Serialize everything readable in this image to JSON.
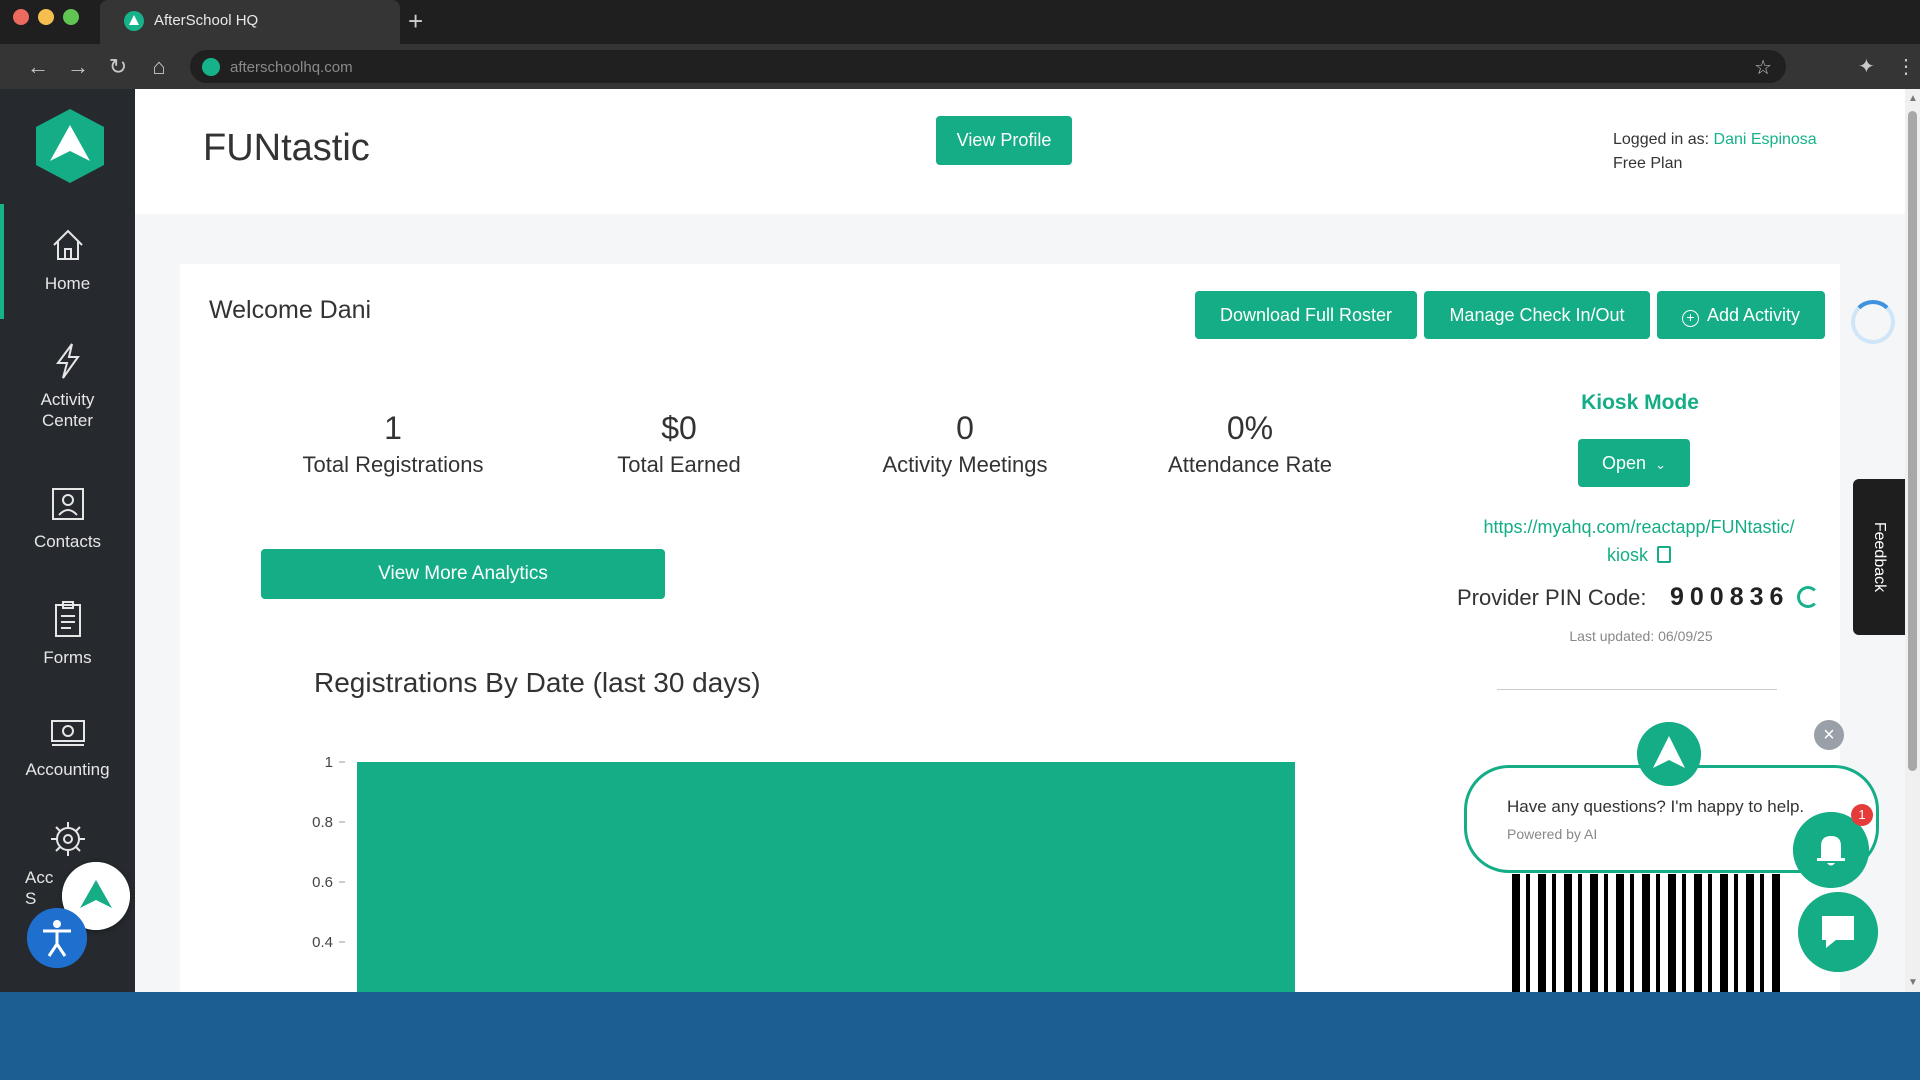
{
  "browser": {
    "tab_title": "AfterSchool HQ",
    "url": "afterschoolhq.com"
  },
  "sidebar": {
    "items": [
      {
        "label": "Home",
        "icon": "home-icon"
      },
      {
        "label": "Activity Center",
        "icon": "lightning-icon"
      },
      {
        "label": "Contacts",
        "icon": "contacts-icon"
      },
      {
        "label": "Forms",
        "icon": "clipboard-icon"
      },
      {
        "label": "Accounting",
        "icon": "cash-icon"
      },
      {
        "label": "Acc S",
        "icon": "gear-icon"
      }
    ]
  },
  "header": {
    "title": "FUNtastic",
    "view_profile": "View Profile",
    "logged_in_label": "Logged in as:",
    "user_name": "Dani Espinosa",
    "plan": "Free Plan"
  },
  "dashboard": {
    "welcome": "Welcome Dani",
    "buttons": {
      "download_roster": "Download Full Roster",
      "manage_checkin": "Manage Check In/Out",
      "add_activity": "Add Activity"
    },
    "stats": [
      {
        "value": "1",
        "label": "Total Registrations"
      },
      {
        "value": "$0",
        "label": "Total Earned"
      },
      {
        "value": "0",
        "label": "Activity Meetings"
      },
      {
        "value": "0%",
        "label": "Attendance Rate"
      }
    ],
    "view_more_analytics": "View More Analytics",
    "chart_title": "Registrations By Date (last 30 days)"
  },
  "kiosk": {
    "title": "Kiosk Mode",
    "open_label": "Open",
    "link_line1": "https://myahq.com/reactapp/FUNtastic/",
    "link_line2": "kiosk",
    "pin_label": "Provider PIN Code:",
    "pin": "900836",
    "last_updated": "Last updated: 06/09/25"
  },
  "chat": {
    "message": "Have any questions? I'm happy to help.",
    "powered_by": "Powered by AI",
    "badge_count": "1"
  },
  "feedback_label": "Feedback",
  "colors": {
    "brand": "#14ad86",
    "sidebar": "#262a2f",
    "accent_blue": "#1f6fcf"
  },
  "chart_data": {
    "type": "bar",
    "title": "Registrations By Date (last 30 days)",
    "y_ticks": [
      "1",
      "0.8",
      "0.6",
      "0.4"
    ],
    "ylim": [
      0,
      1
    ],
    "categories": [
      ""
    ],
    "values": [
      1
    ]
  }
}
